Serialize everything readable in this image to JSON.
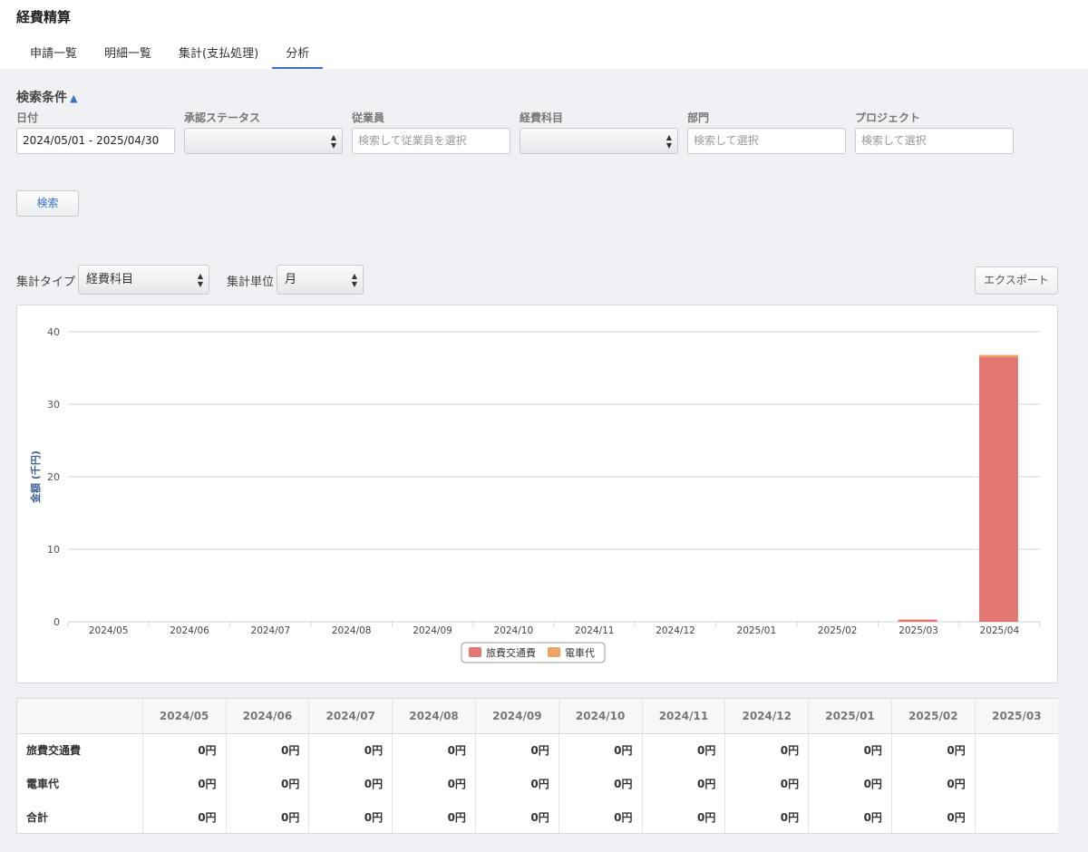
{
  "app": {
    "title": "経費精算"
  },
  "tabs": [
    {
      "label": "申請一覧"
    },
    {
      "label": "明細一覧"
    },
    {
      "label": "集計(支払処理)"
    },
    {
      "label": "分析",
      "active": true
    }
  ],
  "search": {
    "title": "検索条件",
    "toggle_icon": "chevron-up-icon",
    "fields": {
      "date": {
        "label": "日付",
        "value": "2024/05/01 - 2025/04/30"
      },
      "status": {
        "label": "承認ステータス",
        "value": ""
      },
      "employee": {
        "label": "従業員",
        "placeholder": "検索して従業員を選択"
      },
      "category": {
        "label": "経費科目",
        "value": ""
      },
      "department": {
        "label": "部門",
        "placeholder": "検索して選択"
      },
      "project": {
        "label": "プロジェクト",
        "placeholder": "検索して選択"
      }
    },
    "submit_label": "検索"
  },
  "aggregation": {
    "type_label": "集計タイプ",
    "type_value": "経費科目",
    "unit_label": "集計単位",
    "unit_value": "月",
    "export_label": "エクスポート"
  },
  "chart_data": {
    "type": "bar",
    "stacked": true,
    "categories": [
      "2024/05",
      "2024/06",
      "2024/07",
      "2024/08",
      "2024/09",
      "2024/10",
      "2024/11",
      "2024/12",
      "2025/01",
      "2025/02",
      "2025/03",
      "2025/04"
    ],
    "series": [
      {
        "name": "旅費交通費",
        "color": "#e27771",
        "values": [
          0,
          0,
          0,
          0,
          0,
          0,
          0,
          0,
          0,
          0,
          0.3,
          36.5
        ]
      },
      {
        "name": "電車代",
        "color": "#eba463",
        "values": [
          0,
          0,
          0,
          0,
          0,
          0,
          0,
          0,
          0,
          0,
          0,
          0.3
        ]
      }
    ],
    "ylabel": "金額 (千円)",
    "ylim": [
      0,
      40
    ],
    "yticks": [
      "0",
      "10",
      "20",
      "30",
      "40"
    ],
    "grid": true,
    "legend": "bottom-center"
  },
  "table": {
    "columns": [
      "2024/05",
      "2024/06",
      "2024/07",
      "2024/08",
      "2024/09",
      "2024/10",
      "2024/11",
      "2024/12",
      "2025/01",
      "2025/02",
      "2025/03"
    ],
    "rows": [
      {
        "label": "旅費交通費",
        "cells": [
          "0円",
          "0円",
          "0円",
          "0円",
          "0円",
          "0円",
          "0円",
          "0円",
          "0円",
          "0円",
          ""
        ]
      },
      {
        "label": "電車代",
        "cells": [
          "0円",
          "0円",
          "0円",
          "0円",
          "0円",
          "0円",
          "0円",
          "0円",
          "0円",
          "0円",
          ""
        ]
      },
      {
        "label": "合計",
        "cells": [
          "0円",
          "0円",
          "0円",
          "0円",
          "0円",
          "0円",
          "0円",
          "0円",
          "0円",
          "0円",
          ""
        ]
      }
    ]
  }
}
